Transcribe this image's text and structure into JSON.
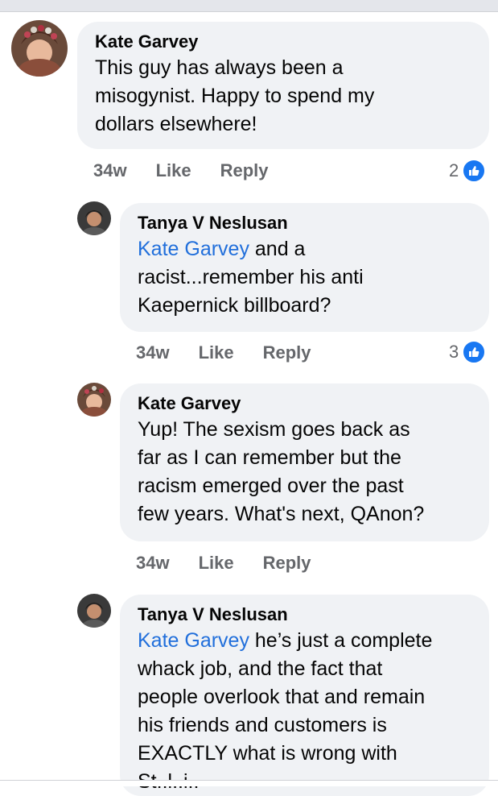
{
  "comments": [
    {
      "author": "Kate Garvey",
      "lines": [
        "This guy has always been a",
        "misogynist. Happy to spend my",
        "dollars elsewhere!"
      ],
      "mention": "",
      "timestamp": "34w",
      "like_label": "Like",
      "reply_label": "Reply",
      "reaction_count": "2",
      "reaction_icon": "like-icon"
    },
    {
      "author": "Tanya V Neslusan",
      "mention": "Kate Garvey",
      "lines": [
        " and a",
        "racist...remember his anti",
        "Kaepernick billboard?"
      ],
      "timestamp": "34w",
      "like_label": "Like",
      "reply_label": "Reply",
      "reaction_count": "3",
      "reaction_icon": "like-icon"
    },
    {
      "author": "Kate Garvey",
      "mention": "",
      "lines": [
        "Yup! The sexism goes back as",
        "far as I can remember but the",
        "racism emerged over the past",
        "few years. What's next, QAnon?"
      ],
      "timestamp": "34w",
      "like_label": "Like",
      "reply_label": "Reply"
    },
    {
      "author": "Tanya V Neslusan",
      "mention": "Kate Garvey",
      "lines": [
        " he’s just a complete",
        "whack job, and the fact that",
        "people overlook that and remain",
        "his friends and customers is",
        "EXACTLY what is wrong with",
        "St..l..i.."
      ]
    }
  ],
  "colors": {
    "bubble": "#f0f2f5",
    "mention": "#216fdb",
    "meta": "#65676b",
    "like_blue": "#1877f2"
  }
}
